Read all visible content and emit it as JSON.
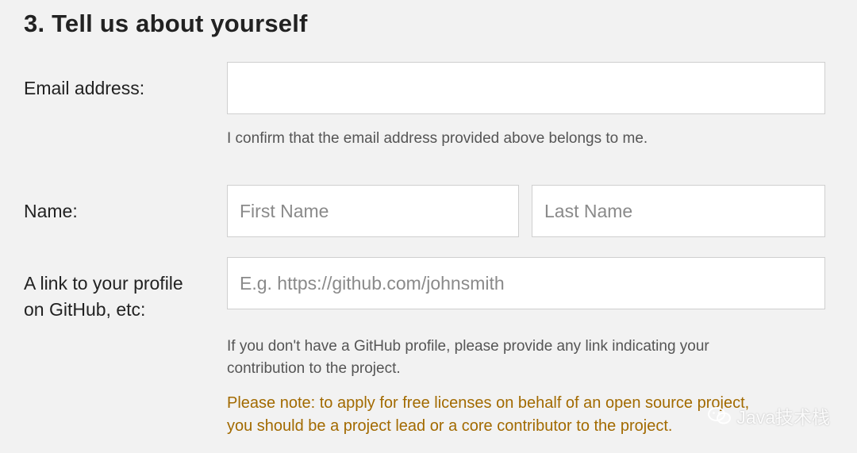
{
  "section": {
    "title": "3. Tell us about yourself"
  },
  "email": {
    "label": "Email address:",
    "value": "",
    "placeholder": "",
    "confirm_text": "I confirm that the email address provided above belongs to me."
  },
  "name": {
    "label": "Name:",
    "first_placeholder": "First Name",
    "last_placeholder": "Last Name"
  },
  "profile": {
    "label_line1": "A link to your profile",
    "label_line2": "on GitHub, etc:",
    "placeholder": "E.g. https://github.com/johnsmith",
    "hint_line1": "If you don't have a GitHub profile, please provide any link indicating your",
    "hint_line2": "contribution to the project."
  },
  "note": {
    "line1": "Please note: to apply for free licenses on behalf of an open source project,",
    "line2": "you should be a project lead or a core contributor to the project.",
    "color": "#a26a00"
  },
  "watermark": {
    "text": "Java技术栈",
    "icon": "wechat-icon"
  }
}
